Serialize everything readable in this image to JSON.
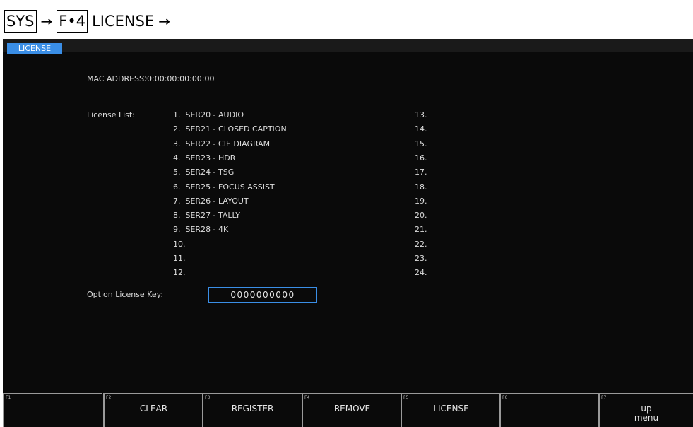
{
  "breadcrumb": {
    "sys": "SYS",
    "arrow": "→",
    "f4": "F•4",
    "license": "LICENSE"
  },
  "tab": {
    "label": "LICENSE"
  },
  "mac": {
    "label": "MAC ADDRESS:",
    "value": "00:00:00:00:00:00"
  },
  "license_list": {
    "label": "License List:",
    "left": [
      "1.  SER20 - AUDIO",
      "2.  SER21 - CLOSED CAPTION",
      "3.  SER22 - CIE DIAGRAM",
      "4.  SER23 - HDR",
      "5.  SER24 - TSG",
      "6.  SER25 - FOCUS ASSIST",
      "7.  SER26 - LAYOUT",
      "8.  SER27 - TALLY",
      "9.  SER28 - 4K",
      "10.",
      "11.",
      "12."
    ],
    "right": [
      "13.",
      "14.",
      "15.",
      "16.",
      "17.",
      "18.",
      "19.",
      "20.",
      "21.",
      "22.",
      "23.",
      "24."
    ]
  },
  "option_key": {
    "label": "Option License Key:",
    "value": "0000000000"
  },
  "fkeys": [
    {
      "num": "F1",
      "label": ""
    },
    {
      "num": "F2",
      "label": "CLEAR"
    },
    {
      "num": "F3",
      "label": "REGISTER"
    },
    {
      "num": "F4",
      "label": "REMOVE"
    },
    {
      "num": "F5",
      "label": "LICENSE"
    },
    {
      "num": "F6",
      "label": ""
    },
    {
      "num": "F7",
      "label": "up\nmenu"
    }
  ]
}
